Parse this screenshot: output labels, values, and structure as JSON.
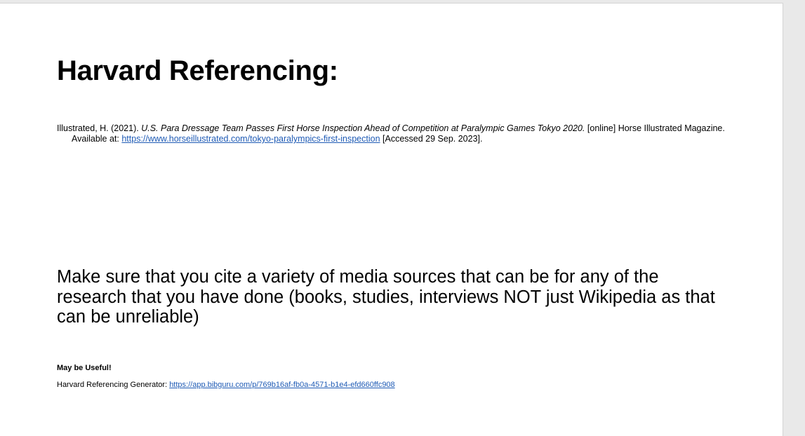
{
  "document": {
    "heading": "Harvard Referencing:",
    "reference": {
      "author_year": "Illustrated, H. (2021). ",
      "title": "U.S. Para Dressage Team Passes First Horse Inspection Ahead of Competition at Paralympic Games Tokyo 2020.",
      "medium": " [online] Horse Illustrated Magazine. Available at: ",
      "url": "https://www.horseillustrated.com/tokyo-paralympics-first-inspection",
      "accessed": " [Accessed 29 Sep. 2023]."
    },
    "body_text": "Make sure that you cite a variety of media sources that can be for any of the research that you have done (books, studies, interviews NOT just Wikipedia as that can be unreliable)",
    "useful": {
      "title": "May be Useful!",
      "generator_label": "Harvard Referencing Generator: ",
      "generator_url": "https://app.bibguru.com/p/769b16af-fb0a-4571-b1e4-efd660ffc908"
    }
  },
  "colors": {
    "link": "#1f5bb5",
    "page_background": "#ffffff",
    "workspace_background": "#e9e9e9"
  }
}
